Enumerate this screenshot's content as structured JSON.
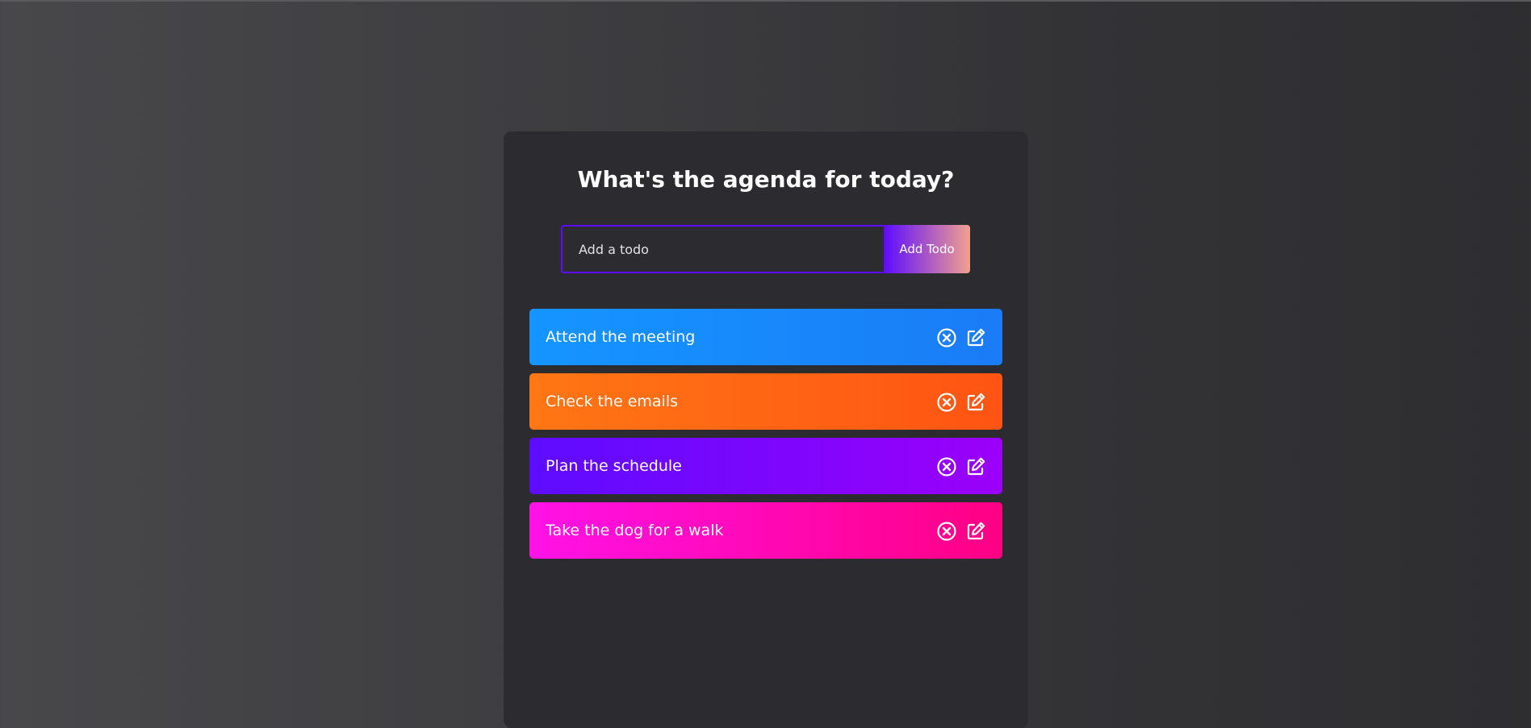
{
  "app": {
    "title": "What's the agenda for today?"
  },
  "form": {
    "input_placeholder": "Add a todo",
    "input_value": "",
    "button_label": "Add Todo"
  },
  "todos": [
    {
      "text": "Attend the meeting",
      "color_start": "#1595ff",
      "color_end": "#1a7cf7",
      "delete_icon": "circle-x-icon",
      "edit_icon": "edit-icon"
    },
    {
      "text": "Check the emails",
      "color_start": "#ff7614",
      "color_end": "#ff5413",
      "delete_icon": "circle-x-icon",
      "edit_icon": "edit-icon"
    },
    {
      "text": "Plan the schedule",
      "color_start": "#5d0cff",
      "color_end": "#9b00fa",
      "delete_icon": "circle-x-icon",
      "edit_icon": "edit-icon"
    },
    {
      "text": "Take the dog for a walk",
      "color_start": "#ff12e7",
      "color_end": "#ff0083",
      "delete_icon": "circle-x-icon",
      "edit_icon": "edit-icon"
    }
  ]
}
